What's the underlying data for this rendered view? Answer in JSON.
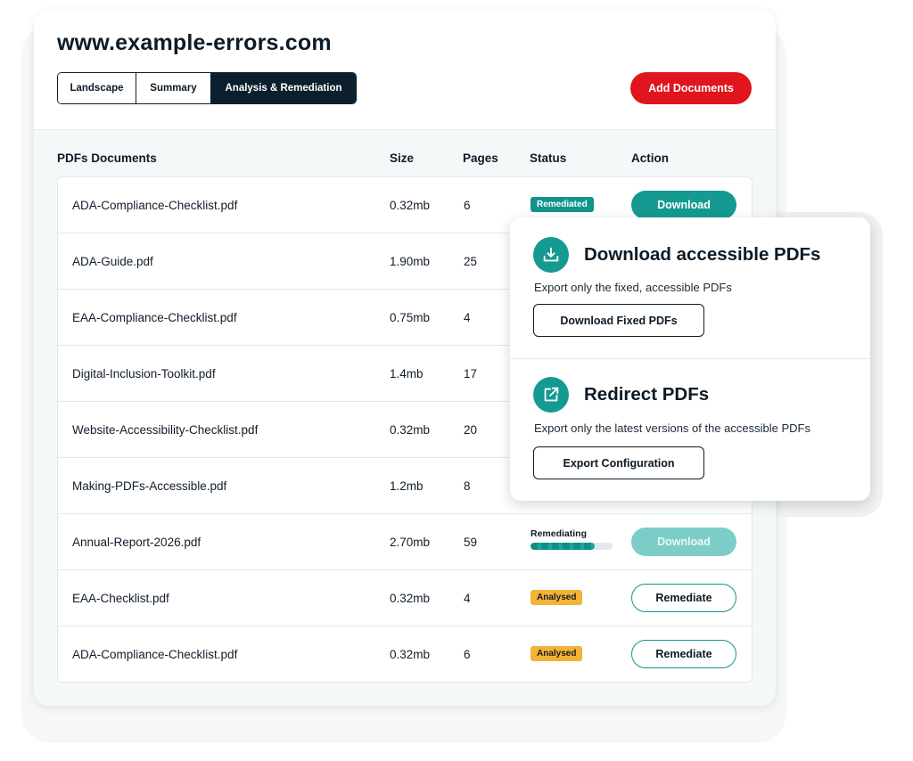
{
  "site": {
    "title": "www.example-errors.com"
  },
  "tabs": [
    {
      "label": "Landscape",
      "active": false
    },
    {
      "label": "Summary",
      "active": false
    },
    {
      "label": "Analysis & Remediation",
      "active": true
    }
  ],
  "header": {
    "add_button": "Add Documents"
  },
  "columns": {
    "name": "PDFs Documents",
    "size": "Size",
    "pages": "Pages",
    "status": "Status",
    "action": "Action"
  },
  "rows": [
    {
      "name": "ADA-Compliance-Checklist.pdf",
      "size": "0.32mb",
      "pages": "6",
      "status": "Remediated",
      "action": "Download"
    },
    {
      "name": "ADA-Guide.pdf",
      "size": "1.90mb",
      "pages": "25",
      "status": "",
      "action": ""
    },
    {
      "name": "EAA-Compliance-Checklist.pdf",
      "size": "0.75mb",
      "pages": "4",
      "status": "",
      "action": ""
    },
    {
      "name": "Digital-Inclusion-Toolkit.pdf",
      "size": "1.4mb",
      "pages": "17",
      "status": "",
      "action": ""
    },
    {
      "name": "Website-Accessibility-Checklist.pdf",
      "size": "0.32mb",
      "pages": "20",
      "status": "",
      "action": ""
    },
    {
      "name": "Making-PDFs-Accessible.pdf",
      "size": "1.2mb",
      "pages": "8",
      "status": "",
      "action": ""
    },
    {
      "name": "Annual-Report-2026.pdf",
      "size": "2.70mb",
      "pages": "59",
      "status": "Remediating",
      "progress": 0.78,
      "action": "Download"
    },
    {
      "name": "EAA-Checklist.pdf",
      "size": "0.32mb",
      "pages": "4",
      "status": "Analysed",
      "action": "Remediate"
    },
    {
      "name": "ADA-Compliance-Checklist.pdf",
      "size": "0.32mb",
      "pages": "6",
      "status": "Analysed",
      "action": "Remediate"
    }
  ],
  "popup": {
    "download": {
      "icon": "download-tray-icon",
      "title": "Download accessible PDFs",
      "description": "Export only the fixed, accessible PDFs",
      "button": "Download Fixed PDFs"
    },
    "redirect": {
      "icon": "redirect-share-icon",
      "title": "Redirect PDFs",
      "description": "Export only the latest versions of the accessible PDFs",
      "button": "Export Configuration"
    }
  },
  "colors": {
    "accent_teal": "#149a91",
    "brand_red": "#e0151d",
    "analysed_yellow": "#f2b338",
    "dark_navy": "#0b1f2c"
  }
}
